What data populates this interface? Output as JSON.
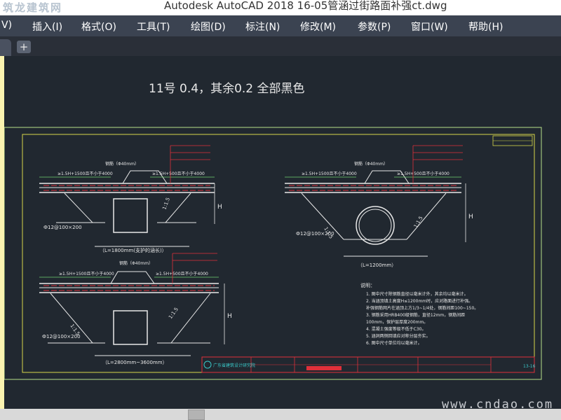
{
  "window": {
    "title": "Autodesk AutoCAD 2018    16-05管涵过街路面补强ct.dwg",
    "logo_text": "筑龙建筑网"
  },
  "menu": {
    "items": [
      "V)",
      "插入(I)",
      "格式(O)",
      "工具(T)",
      "绘图(D)",
      "标注(N)",
      "修改(M)",
      "参数(P)",
      "窗口(W)",
      "帮助(H)"
    ]
  },
  "tabs": {
    "add_label": "+"
  },
  "drawing": {
    "note_heading": "11号 0.4，其余0.2 全部黑色",
    "left_top_caption": "（L=1800mm(支护的涵长)）",
    "left_bottom_caption": "（L=2800mm~3600mm）",
    "right_caption": "（L=1200mm）",
    "dim_top_left": "≥1.5H+1500且不小于4000",
    "dim_top_right": "≥1.5H+500且不小于4000",
    "dim_right_left": "≥1.5H+1500且不小于4000",
    "dim_right_right": "≥1.5H+500且不小于4000",
    "bar_note": "钢筋（Φ40mm）",
    "bar_note2": "（M=3~6mm）",
    "slope_1": "1:1.5",
    "rebar_spec": "Ф12@100×200",
    "h_label": "H",
    "notes_title": "说明：",
    "notes": [
      "1. 图中尺寸除钢筋直径以毫米计外，其余均以毫米计。",
      "2. 当涵顶填土高度H≤1200mm时，应对路面进行补强。",
      "   补强钢筋网片在涵顶上方1/3~1/4处，钢筋间距100~150。",
      "3. 钢筋采用HRB400级钢筋，直径12mm，钢筋间距",
      "   100mm，保护层厚度200mm。",
      "4. 混凝土强度等级不低于C30。",
      "5. 涵洞两侧回填应对称分层夯实。",
      "6. 图中尺寸单位均以毫米计。"
    ],
    "titleblock_name": "广东省建筑设计研究院",
    "titleblock_code": "13-16"
  },
  "watermark": "www.cndao.com",
  "colors": {
    "canvas": "#212830",
    "line_white": "#e8e8e8",
    "line_red": "#e0303a",
    "line_cyan": "#3ac8c8",
    "frame_yellow": "#d6d64a",
    "frame_green": "#b8e08a",
    "dim_green": "#70d070",
    "hatch_magenta": "#d050a0"
  }
}
